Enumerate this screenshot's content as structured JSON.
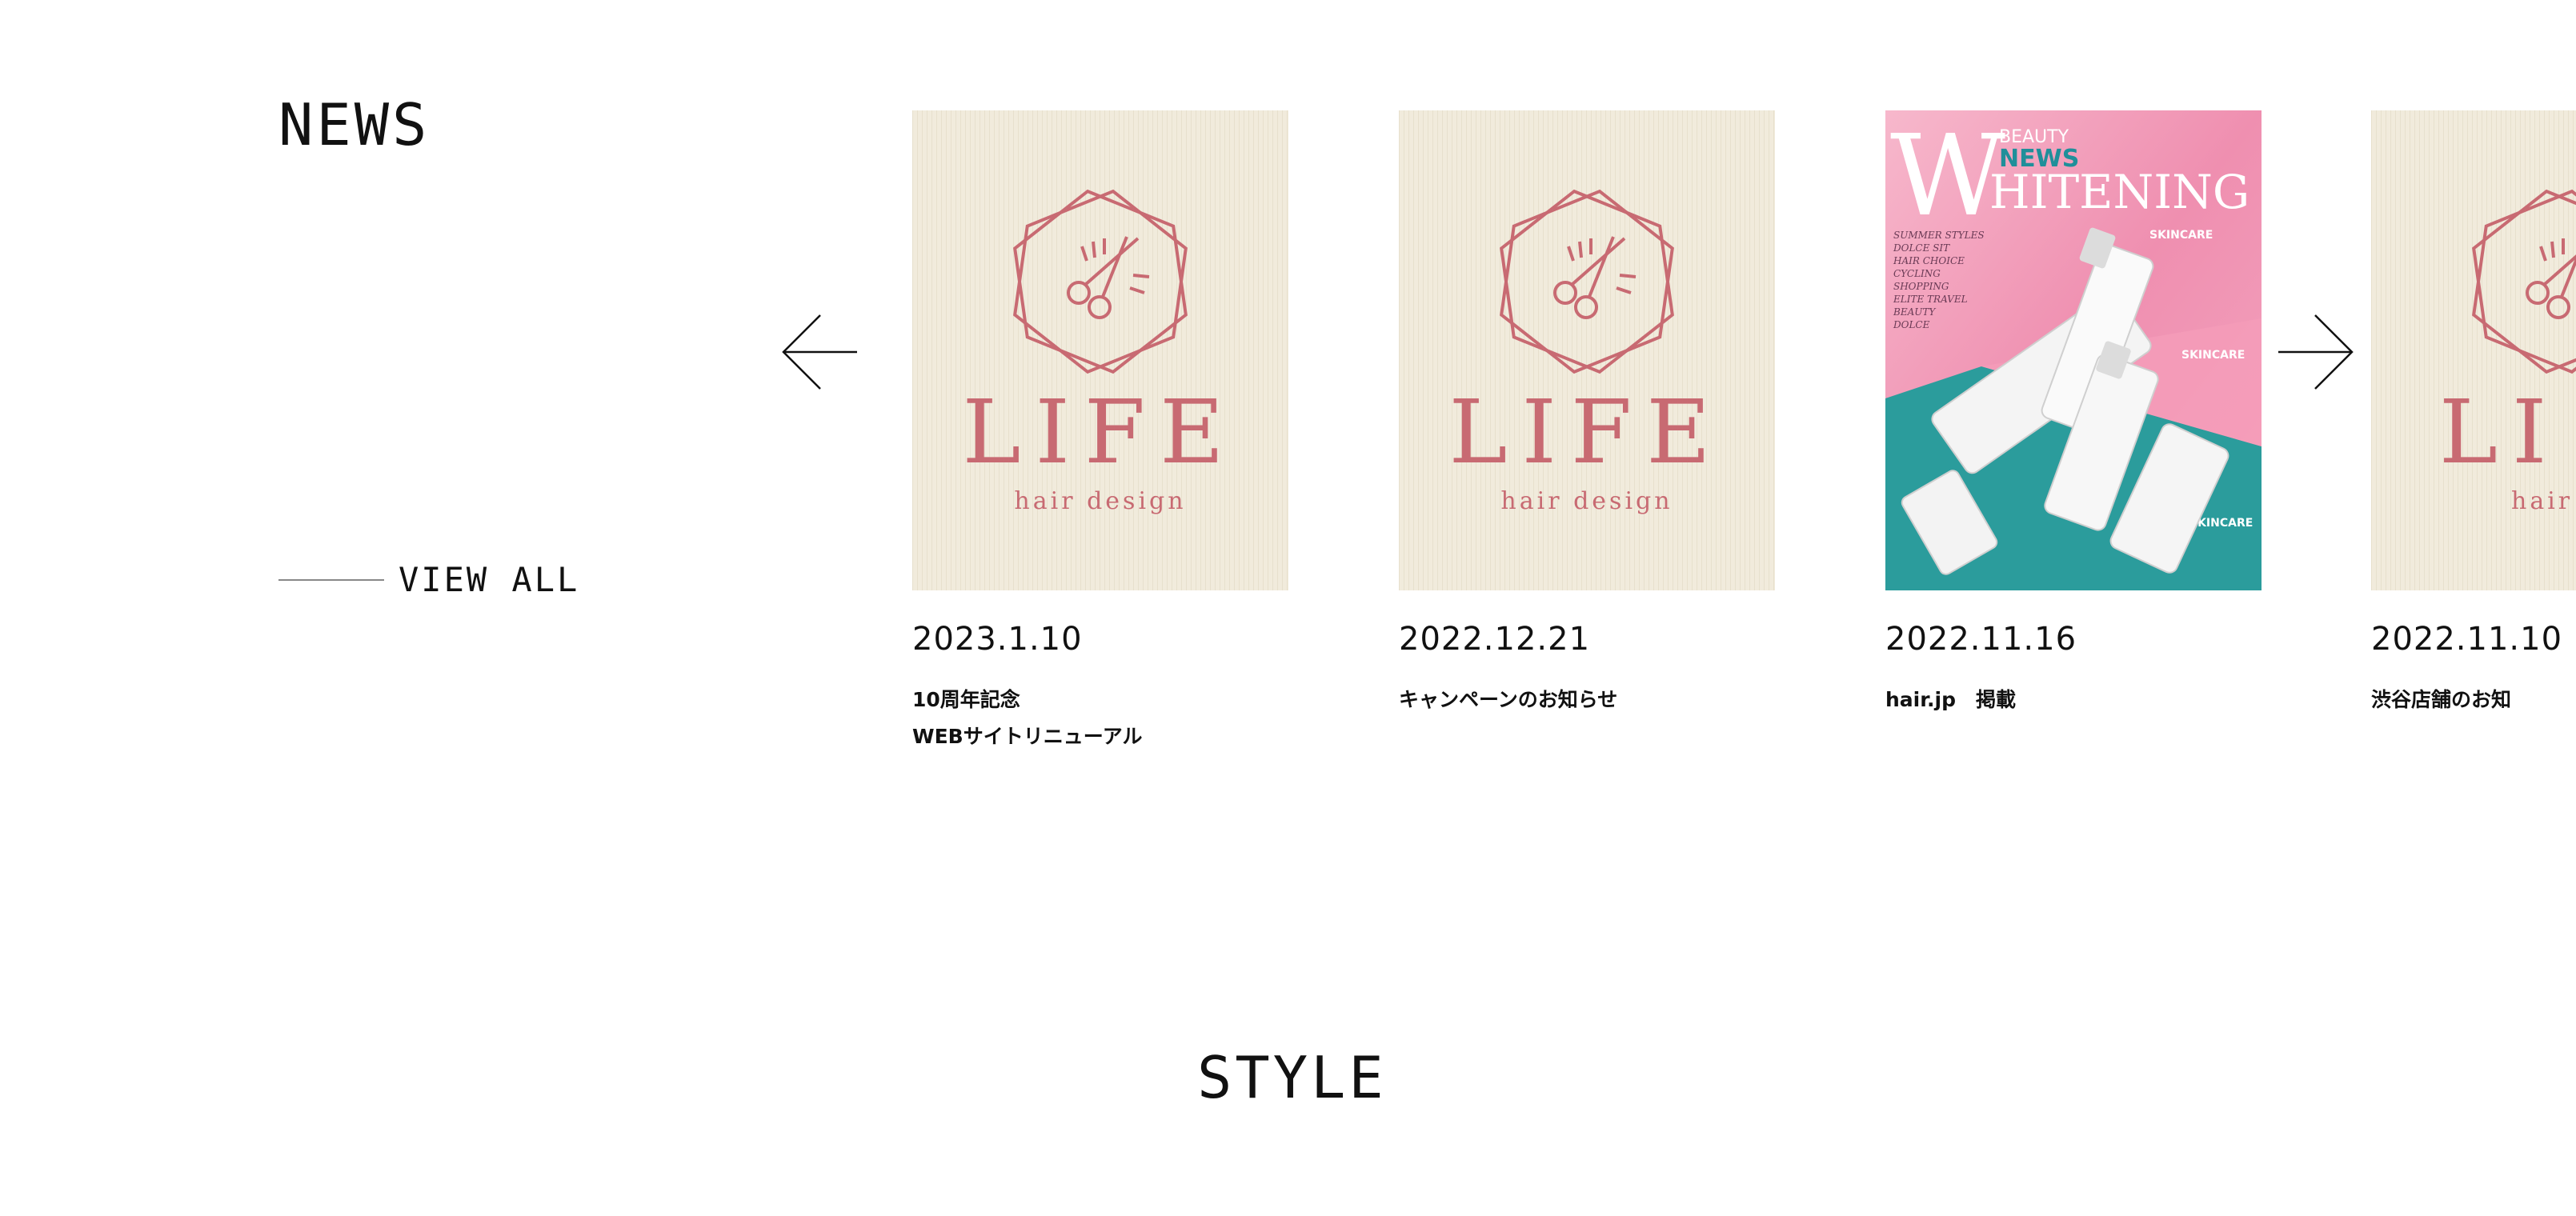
{
  "news": {
    "title": "NEWS",
    "view_all": "VIEW ALL",
    "items": [
      {
        "date": "2023.1.10",
        "lines": [
          "10周年記念",
          "WEBサイトリニューアル"
        ],
        "thumb": {
          "type": "logo",
          "brand": "LIFE",
          "sub": "hair design"
        }
      },
      {
        "date": "2022.12.21",
        "lines": [
          "キャンペーンのお知らせ"
        ],
        "thumb": {
          "type": "logo",
          "brand": "LIFE",
          "sub": "hair design"
        }
      },
      {
        "date": "2022.11.16",
        "lines": [
          "hair.jp　掲載"
        ],
        "thumb": {
          "type": "magazine",
          "big_letter": "W",
          "kicker1": "BEAUTY",
          "kicker2": "NEWS",
          "headline": "HITENING",
          "side_list": [
            "SUMMER STYLES",
            "DOLCE SIT",
            "HAIR CHOICE",
            "CYCLING",
            "SHOPPING",
            "ELITE TRAVEL",
            "BEAUTY",
            "DOLCE"
          ],
          "tags": [
            "SKINCARE",
            "SKINCARE",
            "SKINCARE"
          ]
        }
      },
      {
        "date": "2022.11.10",
        "lines": [
          "渋谷店舗のお知"
        ],
        "thumb": {
          "type": "logo",
          "brand": "LI",
          "sub": "hair de"
        }
      }
    ]
  },
  "style": {
    "title": "STYLE"
  },
  "colors": {
    "logo": "#c86a72",
    "beige": "#f1ebdc",
    "pink": "#f08fb0",
    "teal": "#2b9c9c"
  },
  "icons": {
    "prev": "arrow-left-icon",
    "next": "arrow-right-icon"
  }
}
